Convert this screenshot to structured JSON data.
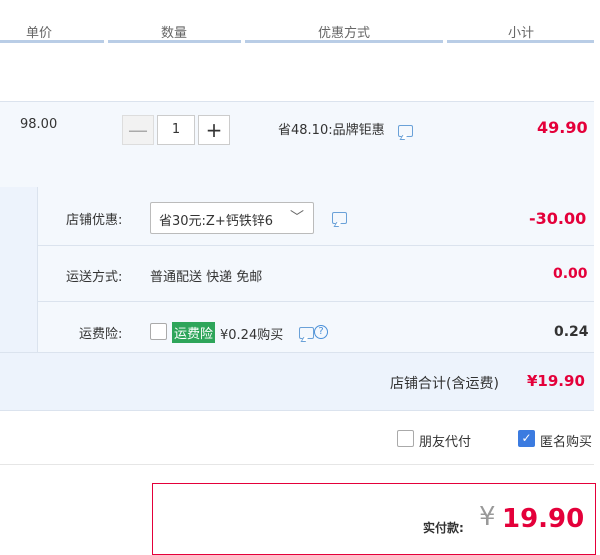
{
  "header": {
    "col_unit_price": "单价",
    "col_quantity": "数量",
    "col_discount": "优惠方式",
    "col_subtotal": "小计"
  },
  "item": {
    "unit_price": "98.00",
    "quantity_minus": "—",
    "quantity": "1",
    "quantity_plus": "+",
    "discount": "省48.10:品牌钜惠",
    "subtotal": "49.90"
  },
  "shop": {
    "discount_label": "店铺优惠:",
    "discount_select": "省30元:Z+钙铁锌6",
    "discount_amount": "-30.00",
    "shipping_label": "运送方式:",
    "shipping_value": "普通配送 快递 免邮",
    "shipping_amount": "0.00",
    "insurance_label": "运费险:",
    "insurance_badge": "运费险",
    "insurance_text": "¥0.24购买",
    "insurance_amount": "0.24",
    "total_label": "店铺合计(含运费)",
    "total_value": "¥19.90"
  },
  "options": {
    "friend_pay": "朋友代付",
    "anonymous": "匿名购买",
    "anonymous_checked": true
  },
  "payment": {
    "label": "实付款:",
    "currency": "¥",
    "amount": "19.90"
  },
  "colors": {
    "accent_red": "#e4003a",
    "checkbox_blue": "#3b7be0",
    "badge_green": "#2ea55a"
  }
}
